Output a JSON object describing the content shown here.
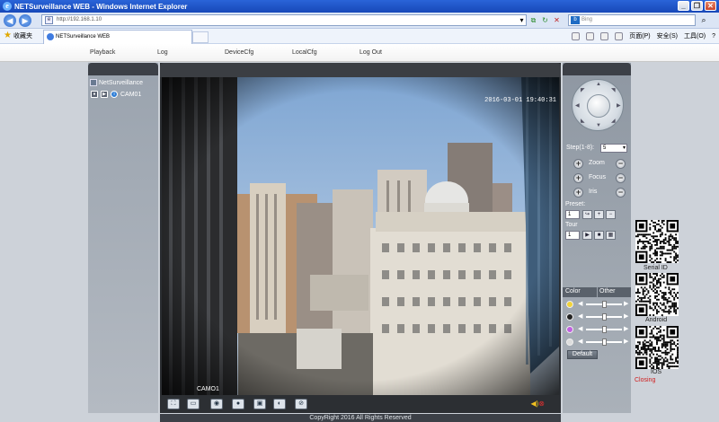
{
  "window": {
    "title": "NETSurveillance WEB - Windows Internet Explorer"
  },
  "browser": {
    "address": "http://192.168.1.10",
    "search_placeholder": "Bing",
    "favorites_label": "收藏夹",
    "tab_title": "NETSurveillance WEB",
    "commands": [
      "页面(P)",
      "安全(S)",
      "工具(O)"
    ]
  },
  "menu": [
    "Playback",
    "Log",
    "DeviceCfg",
    "LocalCfg",
    "Log Out"
  ],
  "device_tree": {
    "device_name": "NetSurveillance",
    "camera": "CAM01"
  },
  "video": {
    "timestamp": "2016-03-01 19:40:31",
    "channel_label": "CAMO1"
  },
  "ptz": {
    "step_label": "Step(1-8):",
    "step_value": "5",
    "zoom_label": "Zoom",
    "focus_label": "Focus",
    "iris_label": "Iris",
    "preset_label": "Preset:",
    "preset_value": "1",
    "tour_label": "Tour",
    "tour_value": "1"
  },
  "color_panel": {
    "tab_color": "Color",
    "tab_other": "Other",
    "default_button": "Default",
    "sliders": [
      {
        "icon": "brightness-icon",
        "color": "#f2d338",
        "level": 0.5
      },
      {
        "icon": "contrast-icon",
        "color": "#222222",
        "level": 0.5
      },
      {
        "icon": "saturation-icon",
        "color": "#c060e0",
        "level": 0.5
      },
      {
        "icon": "hue-icon",
        "color": "#dddddd",
        "level": 0.5
      }
    ]
  },
  "qr": {
    "serial_label": "Serial ID",
    "android_label": "Android",
    "ios_label": "IOS",
    "closing_label": "Closing"
  },
  "footer": {
    "copyright": "CopyRight 2016 All Rights Reserved"
  }
}
